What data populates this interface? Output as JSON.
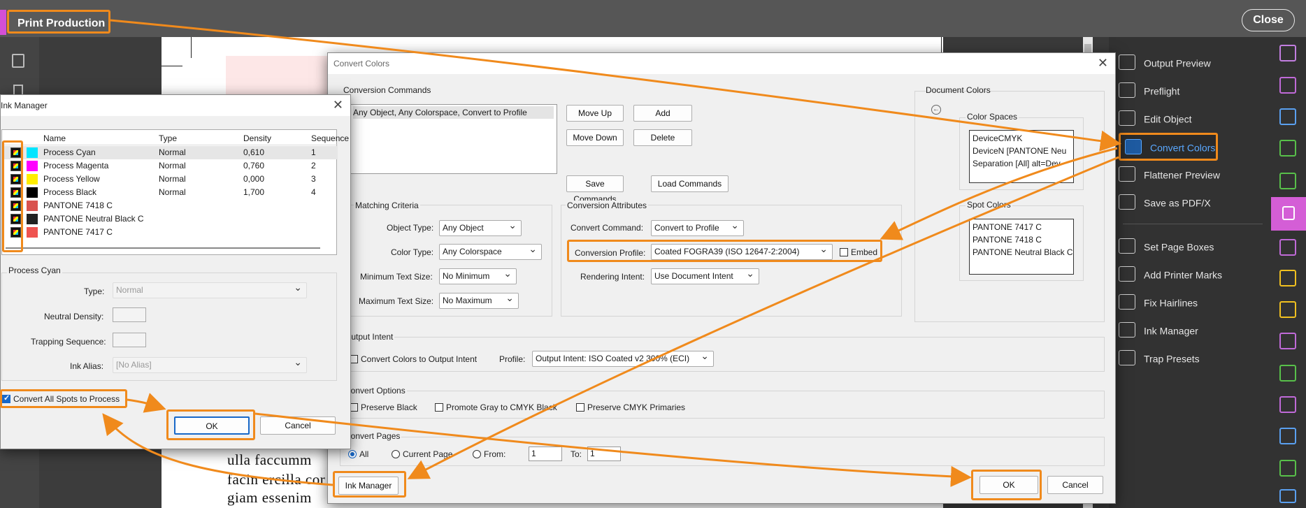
{
  "topbar": {
    "title": "Print Production",
    "close_label": "Close"
  },
  "document_text": [
    "ulla faccumm",
    "facin ercilla cor",
    "giam essenim"
  ],
  "right_panel": {
    "tools": [
      {
        "label": "Output Preview",
        "icon": "output-preview-icon"
      },
      {
        "label": "Preflight",
        "icon": "preflight-icon"
      },
      {
        "label": "Edit Object",
        "icon": "edit-object-icon"
      },
      {
        "label": "Convert Colors",
        "icon": "convert-colors-icon",
        "selected": true
      },
      {
        "label": "Flattener Preview",
        "icon": "flattener-preview-icon"
      },
      {
        "label": "Save as PDF/X",
        "icon": "save-pdfx-icon"
      },
      {
        "label": "Set Page Boxes",
        "icon": "set-page-boxes-icon"
      },
      {
        "label": "Add Printer Marks",
        "icon": "printer-marks-icon"
      },
      {
        "label": "Fix Hairlines",
        "icon": "fix-hairlines-icon"
      },
      {
        "label": "Ink Manager",
        "icon": "ink-manager-icon"
      },
      {
        "label": "Trap Presets",
        "icon": "trap-presets-icon"
      }
    ],
    "accent_color": "#5aa8ff",
    "highlight_color": "#f08a1c"
  },
  "convert_colors": {
    "title": "Convert Colors",
    "conversion_commands_label": "Conversion Commands",
    "commands": [
      "Any Object, Any Colorspace, Convert to Profile"
    ],
    "move_up": "Move Up",
    "add": "Add",
    "move_down": "Move Down",
    "delete": "Delete",
    "save_commands": "Save Commands",
    "load_commands": "Load Commands",
    "matching_criteria": {
      "label": "Matching Criteria",
      "object_type_label": "Object Type:",
      "object_type": "Any Object",
      "color_type_label": "Color Type:",
      "color_type": "Any Colorspace",
      "min_text_label": "Minimum Text Size:",
      "min_text": "No Minimum",
      "max_text_label": "Maximum Text Size:",
      "max_text": "No Maximum"
    },
    "conversion_attributes": {
      "label": "Conversion Attributes",
      "command_label": "Convert Command:",
      "command": "Convert to Profile",
      "profile_label": "Conversion Profile:",
      "profile": "Coated FOGRA39 (ISO 12647-2:2004)",
      "embed_label": "Embed",
      "intent_label": "Rendering Intent:",
      "intent": "Use Document Intent"
    },
    "document_colors": {
      "label": "Document Colors",
      "color_spaces_label": "Color Spaces",
      "color_spaces": [
        "DeviceCMYK",
        "DeviceN [PANTONE Neu",
        "Separation [All] alt=Dev"
      ],
      "spot_colors_label": "Spot Colors",
      "spot_colors": [
        "PANTONE 7417 C",
        "PANTONE 7418 C",
        "PANTONE Neutral Black C"
      ]
    },
    "output_intent": {
      "label": "Output Intent",
      "convert_label": "Convert Colors to Output Intent",
      "profile_label": "Profile:",
      "profile": "Output Intent: ISO Coated v2 300% (ECI)"
    },
    "convert_options": {
      "label": "Convert Options",
      "preserve_black": "Preserve Black",
      "promote_gray": "Promote Gray to CMYK Black",
      "preserve_primaries": "Preserve CMYK Primaries"
    },
    "convert_pages": {
      "label": "Convert Pages",
      "all": "All",
      "current": "Current Page",
      "from": "From:",
      "to": "To:",
      "from_value": "1",
      "to_value": "1"
    },
    "ink_manager_button": "Ink Manager",
    "ok": "OK",
    "cancel": "Cancel"
  },
  "ink_manager": {
    "title": "Ink Manager",
    "columns": [
      "Name",
      "Type",
      "Density",
      "Sequence"
    ],
    "inks": [
      {
        "name": "Process Cyan",
        "type": "Normal",
        "density": "0,610",
        "sequence": "1",
        "color": "#00e5ff"
      },
      {
        "name": "Process Magenta",
        "type": "Normal",
        "density": "0,760",
        "sequence": "2",
        "color": "#ff00ff"
      },
      {
        "name": "Process Yellow",
        "type": "Normal",
        "density": "0,000",
        "sequence": "3",
        "color": "#ffee00"
      },
      {
        "name": "Process Black",
        "type": "Normal",
        "density": "1,700",
        "sequence": "4",
        "color": "#000000"
      },
      {
        "name": "PANTONE 7418 C",
        "type": "",
        "density": "",
        "sequence": "",
        "color": "#d9534f"
      },
      {
        "name": "PANTONE Neutral Black C",
        "type": "",
        "density": "",
        "sequence": "",
        "color": "#222222"
      },
      {
        "name": "PANTONE 7417 C",
        "type": "",
        "density": "",
        "sequence": "",
        "color": "#ef5350"
      }
    ],
    "detail": {
      "group_label": "Process Cyan",
      "type_label": "Type:",
      "type": "Normal",
      "density_label": "Neutral Density:",
      "trapping_label": "Trapping Sequence:",
      "alias_label": "Ink Alias:",
      "alias": "[No Alias]"
    },
    "convert_spots_label": "Convert All Spots to Process",
    "ok": "OK",
    "cancel": "Cancel"
  }
}
